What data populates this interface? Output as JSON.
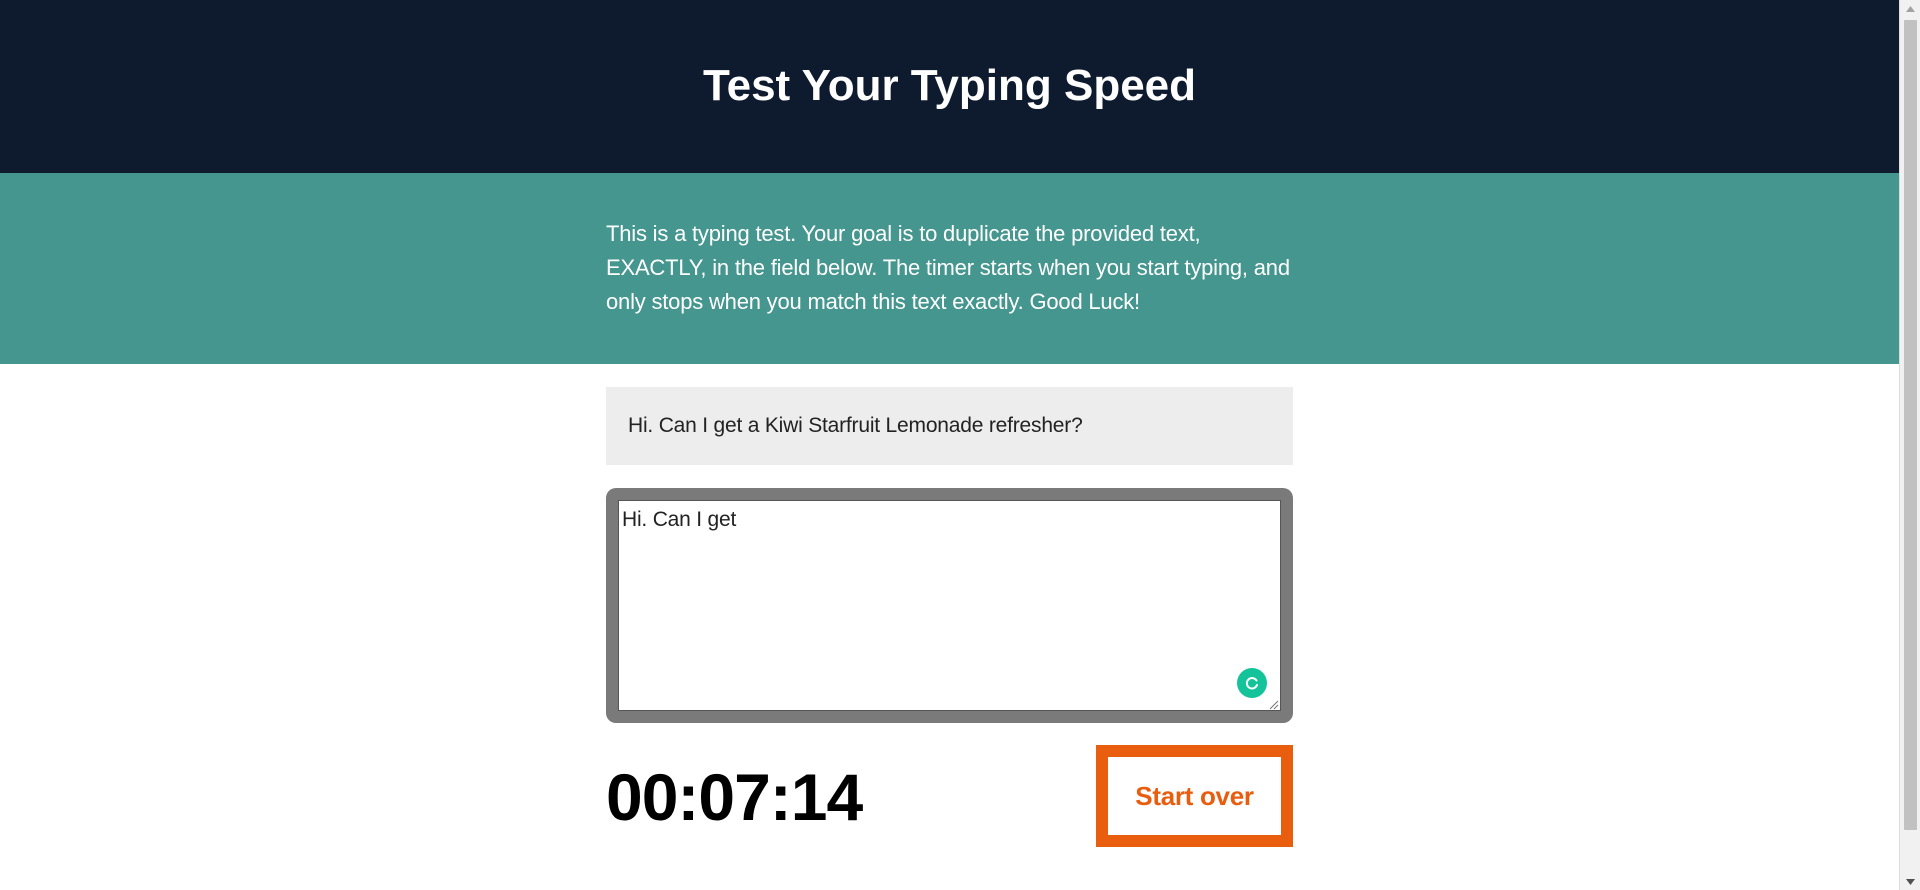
{
  "masthead": {
    "title": "Test Your Typing Speed"
  },
  "intro": {
    "text": "This is a typing test. Your goal is to duplicate the provided text, EXACTLY, in the field below. The timer starts when you start typing, and only stops when you match this text exactly. Good Luck!"
  },
  "test": {
    "origin_text": "Hi. Can I get a Kiwi Starfruit Lemonade refresher?",
    "typed_value": "Hi. Can I get"
  },
  "meta": {
    "timer": "00:07:14",
    "reset_label": "Start over"
  },
  "colors": {
    "masthead_bg": "#0e1b2f",
    "intro_bg": "#44968e",
    "accent": "#e95d0f",
    "badge": "#15c39a"
  },
  "icons": {
    "grammar_badge": "grammarly-icon",
    "resize": "resize-grip-icon"
  }
}
